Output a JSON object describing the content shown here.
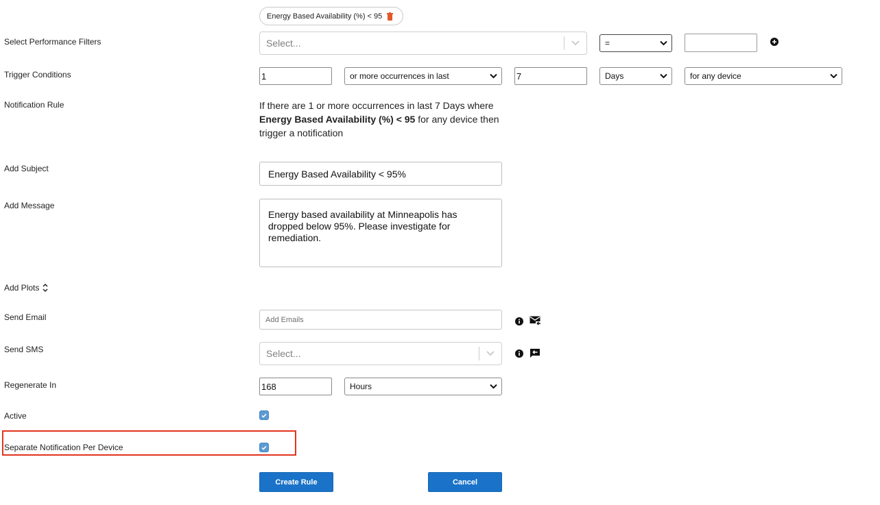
{
  "filter_chip": {
    "label": "Energy Based Availability (%) < 95",
    "delete_icon": "trash-icon"
  },
  "labels": {
    "performance_filters": "Select Performance Filters",
    "trigger_conditions": "Trigger Conditions",
    "notification_rule": "Notification Rule",
    "add_subject": "Add Subject",
    "add_message": "Add Message",
    "add_plots": "Add Plots",
    "send_email": "Send Email",
    "send_sms": "Send SMS",
    "regenerate_in": "Regenerate In",
    "active": "Active",
    "separate_notification": "Separate Notification Per Device"
  },
  "performance_filters": {
    "metric_placeholder": "Select...",
    "operator": "=",
    "value": "",
    "add_icon": "plus-circle-icon"
  },
  "trigger": {
    "count": "1",
    "occurrence_option": "or more occurrences in last",
    "period": "7",
    "period_unit": "Days",
    "scope": "for any device"
  },
  "notification_rule": {
    "part1": "If there are 1 or more occurrences in last 7 Days where",
    "bold": "Energy Based Availability (%) < 95",
    "part2": " for any device then",
    "part3": "trigger a notification"
  },
  "subject": {
    "value": "Energy Based Availability < 95%"
  },
  "message": {
    "value": "Energy based availability at Minneapolis has dropped below 95%. Please investigate for remediation."
  },
  "email": {
    "placeholder": "Add Emails",
    "info_icon": "info-icon",
    "action_icon": "mail-forward-icon"
  },
  "sms": {
    "placeholder": "Select...",
    "info_icon": "info-icon",
    "action_icon": "message-reply-icon"
  },
  "regenerate": {
    "value": "168",
    "unit": "Hours"
  },
  "active": {
    "checked": true
  },
  "separate_notification": {
    "checked": true
  },
  "buttons": {
    "create": "Create Rule",
    "cancel": "Cancel"
  },
  "colors": {
    "primary": "#1a73c8",
    "checkbox": "#5b9bd5",
    "highlight": "#e1341e",
    "trash": "#e2582b"
  }
}
